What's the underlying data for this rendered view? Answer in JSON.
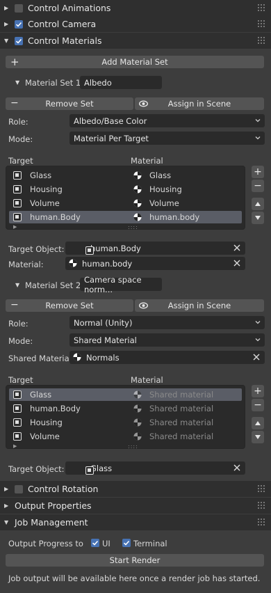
{
  "panels": {
    "control_animations": "Control Animations",
    "control_camera": "Control Camera",
    "control_materials": "Control Materials",
    "control_rotation": "Control Rotation",
    "output_properties": "Output Properties",
    "job_management": "Job Management"
  },
  "materials": {
    "add_set_label": "Add Material Set",
    "set1": {
      "label": "Material Set 1",
      "name": "Albedo",
      "remove_label": "Remove Set",
      "assign_label": "Assign in Scene",
      "role_label": "Role:",
      "role_value": "Albedo/Base Color",
      "mode_label": "Mode:",
      "mode_value": "Material Per Target",
      "col_target": "Target",
      "col_material": "Material",
      "rows": [
        {
          "target": "Glass",
          "material": "Glass"
        },
        {
          "target": "Housing",
          "material": "Housing"
        },
        {
          "target": "Volume",
          "material": "Volume"
        },
        {
          "target": "human.Body",
          "material": "human.body"
        }
      ],
      "target_object_label": "Target Object:",
      "target_object_value": "human.Body",
      "material_label": "Material:",
      "material_value": "human.body"
    },
    "set2": {
      "label": "Material Set 2",
      "name": "Camera space norm...",
      "remove_label": "Remove Set",
      "assign_label": "Assign in Scene",
      "role_label": "Role:",
      "role_value": "Normal (Unity)",
      "mode_label": "Mode:",
      "mode_value": "Shared Material",
      "shared_label": "Shared Material:",
      "shared_value": "Normals",
      "col_target": "Target",
      "col_material": "Material",
      "rows": [
        {
          "target": "Glass",
          "material": "Shared material"
        },
        {
          "target": "human.Body",
          "material": "Shared material"
        },
        {
          "target": "Housing",
          "material": "Shared material"
        },
        {
          "target": "Volume",
          "material": "Shared material"
        }
      ],
      "target_object_label": "Target Object:",
      "target_object_value": "Glass"
    }
  },
  "job": {
    "output_progress_label": "Output Progress to",
    "ui_label": "UI",
    "terminal_label": "Terminal",
    "start_render_label": "Start Render",
    "info_text": "Job output will be available here once a render job has started."
  },
  "colors": {
    "accent": "#4772b3",
    "selected_row": "#5a5d66"
  }
}
